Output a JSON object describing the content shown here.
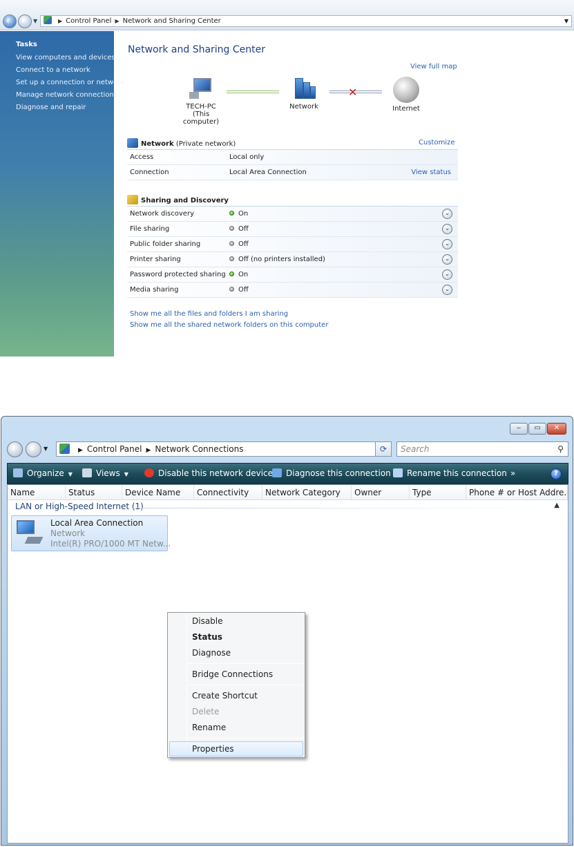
{
  "nsc": {
    "breadcrumb": [
      "Control Panel",
      "Network and Sharing Center"
    ],
    "tasks": {
      "header": "Tasks",
      "items": [
        "View computers and devices",
        "Connect to a network",
        "Set up a connection or network",
        "Manage network connections",
        "Diagnose and repair"
      ]
    },
    "title": "Network and Sharing Center",
    "view_full_map": "View full map",
    "map": {
      "computer_name": "TECH-PC",
      "computer_sub": "(This computer)",
      "network": "Network",
      "internet": "Internet"
    },
    "network_section": {
      "name": "Network",
      "type": "(Private network)",
      "customize": "Customize",
      "rows": [
        {
          "label": "Access",
          "value": "Local only",
          "action": ""
        },
        {
          "label": "Connection",
          "value": "Local Area Connection",
          "action": "View status"
        }
      ]
    },
    "sharing_section": {
      "title": "Sharing and Discovery",
      "rows": [
        {
          "label": "Network discovery",
          "value": "On",
          "state": "on"
        },
        {
          "label": "File sharing",
          "value": "Off",
          "state": "off"
        },
        {
          "label": "Public folder sharing",
          "value": "Off",
          "state": "off"
        },
        {
          "label": "Printer sharing",
          "value": "Off (no printers installed)",
          "state": "off"
        },
        {
          "label": "Password protected sharing",
          "value": "On",
          "state": "on"
        },
        {
          "label": "Media sharing",
          "value": "Off",
          "state": "off"
        }
      ]
    },
    "links": [
      "Show me all the files and folders I am sharing",
      "Show me all the shared network folders on this computer"
    ]
  },
  "nc": {
    "breadcrumb": [
      "Control Panel",
      "Network Connections"
    ],
    "search_placeholder": "Search",
    "toolbar": {
      "organize": "Organize",
      "views": "Views",
      "disable": "Disable this network device",
      "diagnose": "Diagnose this connection",
      "rename": "Rename this connection",
      "more": "»",
      "help": "?"
    },
    "columns": [
      "Name",
      "Status",
      "Device Name",
      "Connectivity",
      "Network Category",
      "Owner",
      "Type",
      "Phone # or Host Addre..."
    ],
    "group_label": "LAN or High-Speed Internet (1)",
    "connection": {
      "name": "Local Area Connection",
      "status": "Network",
      "device": "Intel(R) PRO/1000 MT Netw..."
    },
    "context_menu": [
      "Disable",
      "Status",
      "Diagnose",
      "Bridge Connections",
      "Create Shortcut",
      "Delete",
      "Rename",
      "Properties"
    ]
  },
  "colors": {
    "task_pane_top": "#2e6aa8",
    "task_pane_bottom": "#76b58c",
    "title_blue": "#1f3f86",
    "link_blue": "#2a5fb0",
    "command_bar": "#1e4c5a",
    "status_on": "#3d9b1e",
    "status_off": "#8f8f8f"
  }
}
